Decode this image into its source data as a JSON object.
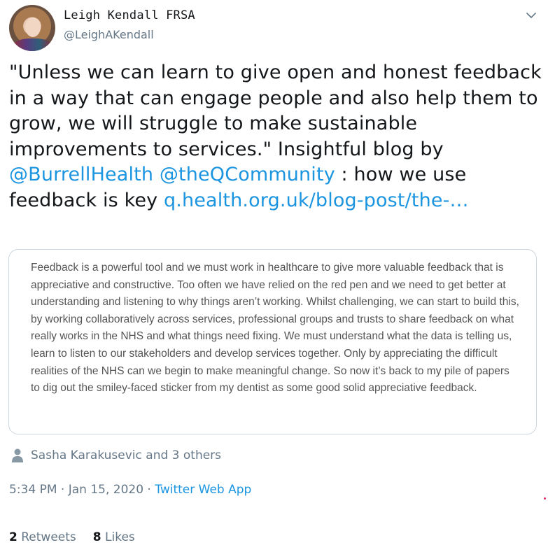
{
  "author": {
    "display_name": "Leigh Kendall FRSA",
    "handle": "@LeighAKendall"
  },
  "tweet": {
    "text_part1": "\"Unless we can learn to give open and honest feedback in a way that can engage people and also help them to grow, we will struggle to make sustainable improvements to services.\" Insightful blog by ",
    "mention1": "@BurrellHealth",
    "mention2": "@theQCommunity",
    "text_part2": " : how we use feedback is key ",
    "link": "q.health.org.uk/blog-post/the-…"
  },
  "card": {
    "text": "Feedback is a powerful tool and we must work in healthcare to give more valuable feedback that is appreciative and constructive. Too often we have relied on the red pen and we need to get better at understanding and listening to why things aren’t working. Whilst challenging, we can start to build this, by working collaboratively across services, professional groups and trusts to share feedback on what really works in the NHS and what things need fixing. We must understand what the data is telling us, learn to listen to our stakeholders and develop services together. Only by appreciating the difficult realities of the NHS can we begin to make meaningful change. So now it’s back to my pile of papers to dig out the smiley-faced sticker from my dentist as some good solid appreciative feedback."
  },
  "liked_by": "Sasha Karakusevic and 3 others",
  "meta": {
    "time": "5:34 PM",
    "separator": " · ",
    "date": "Jan 15, 2020",
    "app": "Twitter Web App"
  },
  "stats": {
    "retweets_count": "2",
    "retweets_label": "Retweets",
    "likes_count": "8",
    "likes_label": "Likes"
  },
  "colors": {
    "link": "#1b95e0",
    "secondary_text": "#657786",
    "border": "#ccd6dd"
  },
  "icons": [
    "chevron-down-icon",
    "user-icon"
  ]
}
